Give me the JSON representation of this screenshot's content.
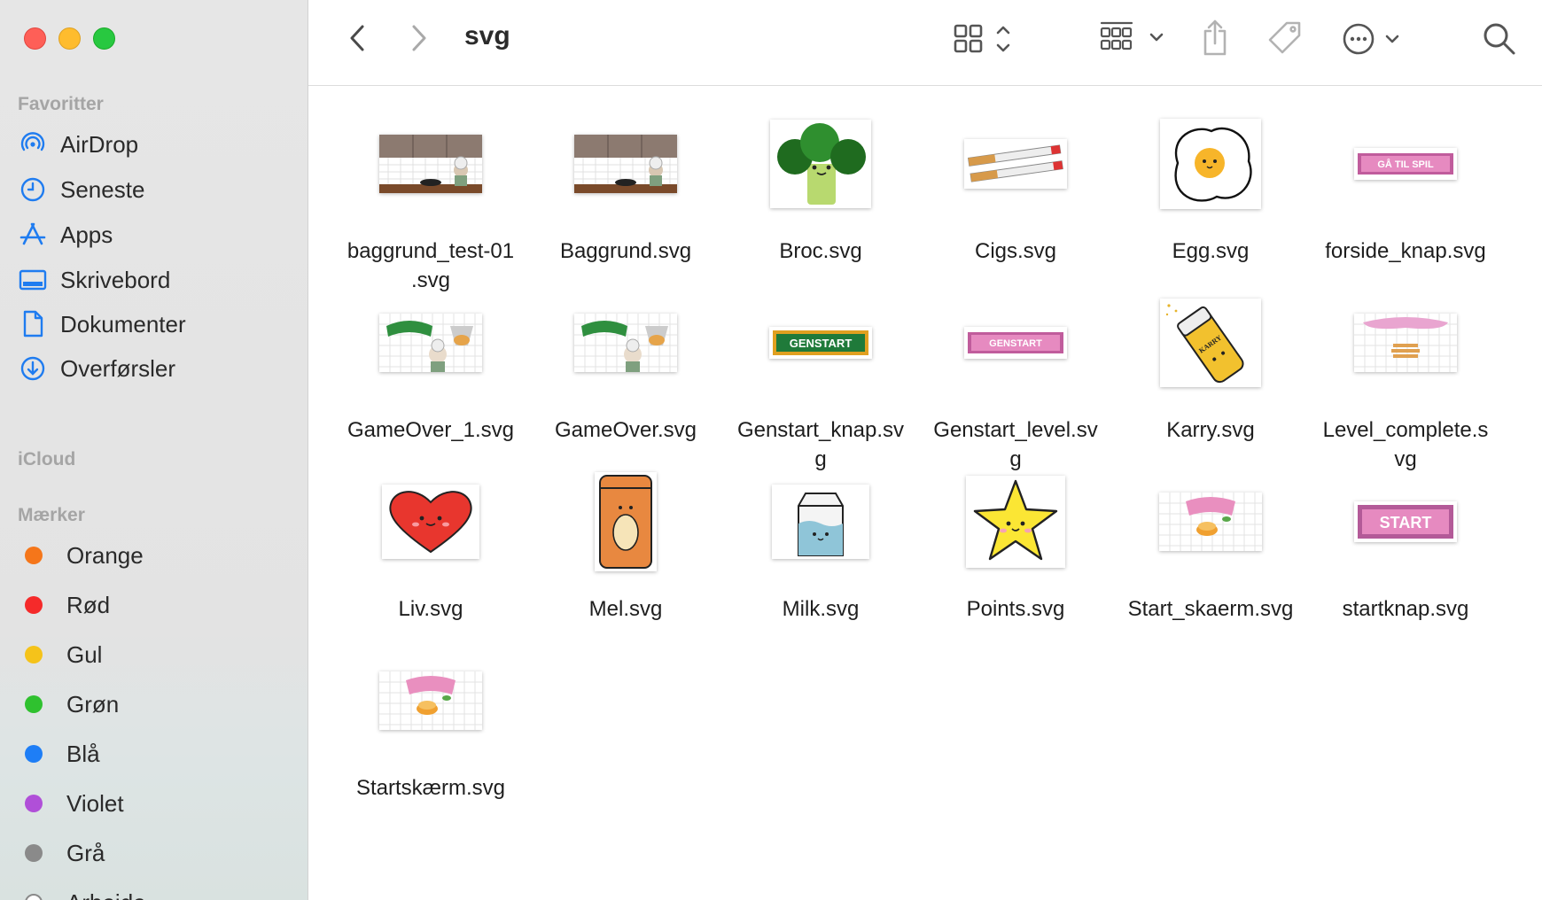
{
  "window": {
    "title": "svg"
  },
  "sidebar": {
    "sections": {
      "favorites": "Favoritter",
      "icloud": "iCloud",
      "tags": "Mærker"
    },
    "favorites": [
      {
        "label": "AirDrop",
        "icon": "airdrop-icon"
      },
      {
        "label": "Seneste",
        "icon": "clock-icon"
      },
      {
        "label": "Apps",
        "icon": "apps-icon"
      },
      {
        "label": "Skrivebord",
        "icon": "desktop-icon"
      },
      {
        "label": "Dokumenter",
        "icon": "document-icon"
      },
      {
        "label": "Overførsler",
        "icon": "download-icon"
      }
    ],
    "tags": [
      {
        "label": "Orange",
        "color": "#f5761a"
      },
      {
        "label": "Rød",
        "color": "#f52a2a"
      },
      {
        "label": "Gul",
        "color": "#f5c31a"
      },
      {
        "label": "Grøn",
        "color": "#2fc12f"
      },
      {
        "label": "Blå",
        "color": "#1e7ef6"
      },
      {
        "label": "Violet",
        "color": "#b04fd8"
      },
      {
        "label": "Grå",
        "color": "#8a8a8a"
      },
      {
        "label": "Arbejde",
        "color": "#ffffff"
      }
    ]
  },
  "toolbar": {
    "back": "back-icon",
    "forward": "forward-icon",
    "view": "icon-grid-view-icon",
    "group": "group-icon",
    "share": "share-icon",
    "tag": "tag-icon",
    "more": "more-icon",
    "search": "search-icon"
  },
  "files": [
    {
      "line1": "baggrund_test-01",
      "line2": ".svg",
      "thumb": "kitchen"
    },
    {
      "line1": "Baggrund.svg",
      "line2": "",
      "thumb": "kitchen"
    },
    {
      "line1": "Broc.svg",
      "line2": "",
      "thumb": "broc"
    },
    {
      "line1": "Cigs.svg",
      "line2": "",
      "thumb": "cigs"
    },
    {
      "line1": "Egg.svg",
      "line2": "",
      "thumb": "egg"
    },
    {
      "line1": "forside_knap.svg",
      "line2": "",
      "thumb": "btn-gatil"
    },
    {
      "line1": "GameOver_1.svg",
      "line2": "",
      "thumb": "gameover"
    },
    {
      "line1": "GameOver.svg",
      "line2": "",
      "thumb": "gameover"
    },
    {
      "line1": "Genstart_knap.sv",
      "line2": "g",
      "thumb": "btn-genstart-green"
    },
    {
      "line1": "Genstart_level.sv",
      "line2": "g",
      "thumb": "btn-genstart-pink"
    },
    {
      "line1": "Karry.svg",
      "line2": "",
      "thumb": "karry"
    },
    {
      "line1": "Level_complete.s",
      "line2": "vg",
      "thumb": "level"
    },
    {
      "line1": "Liv.svg",
      "line2": "",
      "thumb": "heart"
    },
    {
      "line1": "Mel.svg",
      "line2": "",
      "thumb": "mel"
    },
    {
      "line1": "Milk.svg",
      "line2": "",
      "thumb": "milk"
    },
    {
      "line1": "Points.svg",
      "line2": "",
      "thumb": "star"
    },
    {
      "line1": "Start_skaerm.svg",
      "line2": "",
      "thumb": "startscreen"
    },
    {
      "line1": "startknap.svg",
      "line2": "",
      "thumb": "btn-start"
    },
    {
      "line1": "Startskærm.svg",
      "line2": "",
      "thumb": "startscreen"
    }
  ],
  "thumb_text": {
    "gatil": "GÅ TIL SPIL",
    "genstart": "GENSTART",
    "start": "START",
    "karry": "KARRY"
  }
}
